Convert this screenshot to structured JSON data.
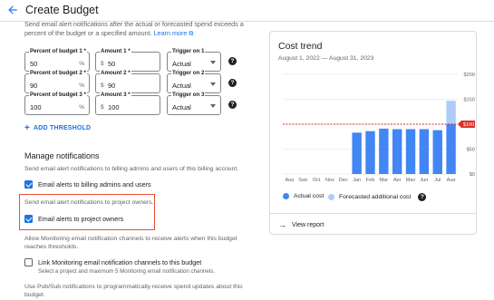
{
  "header": {
    "title": "Create Budget",
    "back_icon": "arrow-back-icon"
  },
  "intro": {
    "text": "Send email alert notifications after the actual or forecasted spend exceeds a percent of the budget or a specified amount.",
    "learn_more": "Learn more"
  },
  "thresholds": [
    {
      "percent_label": "Percent of budget 1 *",
      "percent": "50",
      "percent_suffix": "%",
      "amount_label": "Amount 1 *",
      "amount_prefix": "$",
      "amount": "50",
      "trigger_label": "Trigger on 1",
      "trigger": "Actual"
    },
    {
      "percent_label": "Percent of budget 2 *",
      "percent": "90",
      "percent_suffix": "%",
      "amount_label": "Amount 2 *",
      "amount_prefix": "$",
      "amount": "90",
      "trigger_label": "Trigger on 2",
      "trigger": "Actual"
    },
    {
      "percent_label": "Percent of budget 3 *",
      "percent": "100",
      "percent_suffix": "%",
      "amount_label": "Amount 3 *",
      "amount_prefix": "$",
      "amount": "100",
      "trigger_label": "Trigger on 3",
      "trigger": "Actual"
    }
  ],
  "add_threshold_label": "ADD THRESHOLD",
  "notifications": {
    "title": "Manage notifications",
    "desc": "Send email alert notifications to billing admins and users of this billing account.",
    "billing_admins_label": "Email alerts to billing admins and users",
    "billing_admins_checked": true,
    "project_owners_desc": "Send email alert notifications to project owners.",
    "project_owners_label": "Email alerts to project owners",
    "project_owners_checked": true,
    "monitoring_desc": "Allow Monitoring email notification channels to receive alerts when this budget reaches thresholds.",
    "monitoring_label": "Link Monitoring email notification channels to this budget",
    "monitoring_checked": false,
    "monitoring_sub": "Select a project and maximum 5 Monitoring email notification channels.",
    "pubsub_desc": "Use Pub/Sub notifications to programmatically receive spend updates about this budget."
  },
  "card": {
    "title": "Cost trend",
    "subtitle": "August 1, 2022 — August 31, 2023",
    "legend_actual": "Actual cost",
    "legend_forecast": "Forecasted additional cost",
    "view_report": "View report"
  },
  "colors": {
    "accent": "#1a73e8",
    "actual": "#4285f4",
    "forecast": "#aecbfa",
    "budget_line": "#d93025",
    "highlight": "#e8512d"
  },
  "chart_data": {
    "type": "bar",
    "title": "Cost trend",
    "categories": [
      "Aug",
      "Sep",
      "Oct",
      "Nov",
      "Dec",
      "Jan",
      "Feb",
      "Mar",
      "Apr",
      "May",
      "Jun",
      "Jul",
      "Aug"
    ],
    "series": [
      {
        "name": "Actual cost",
        "values": [
          0,
          0,
          0,
          0,
          0,
          83,
          86,
          91,
          90,
          90,
          90,
          88,
          100
        ]
      },
      {
        "name": "Forecasted additional cost",
        "values": [
          0,
          0,
          0,
          0,
          0,
          0,
          0,
          0,
          0,
          0,
          0,
          0,
          47
        ]
      }
    ],
    "stacked": true,
    "yticks": [
      "$0",
      "$50",
      "$100",
      "$150",
      "$200"
    ],
    "ylim": [
      0,
      200
    ],
    "budget": 100,
    "budget_label": "$100",
    "grid": true
  }
}
